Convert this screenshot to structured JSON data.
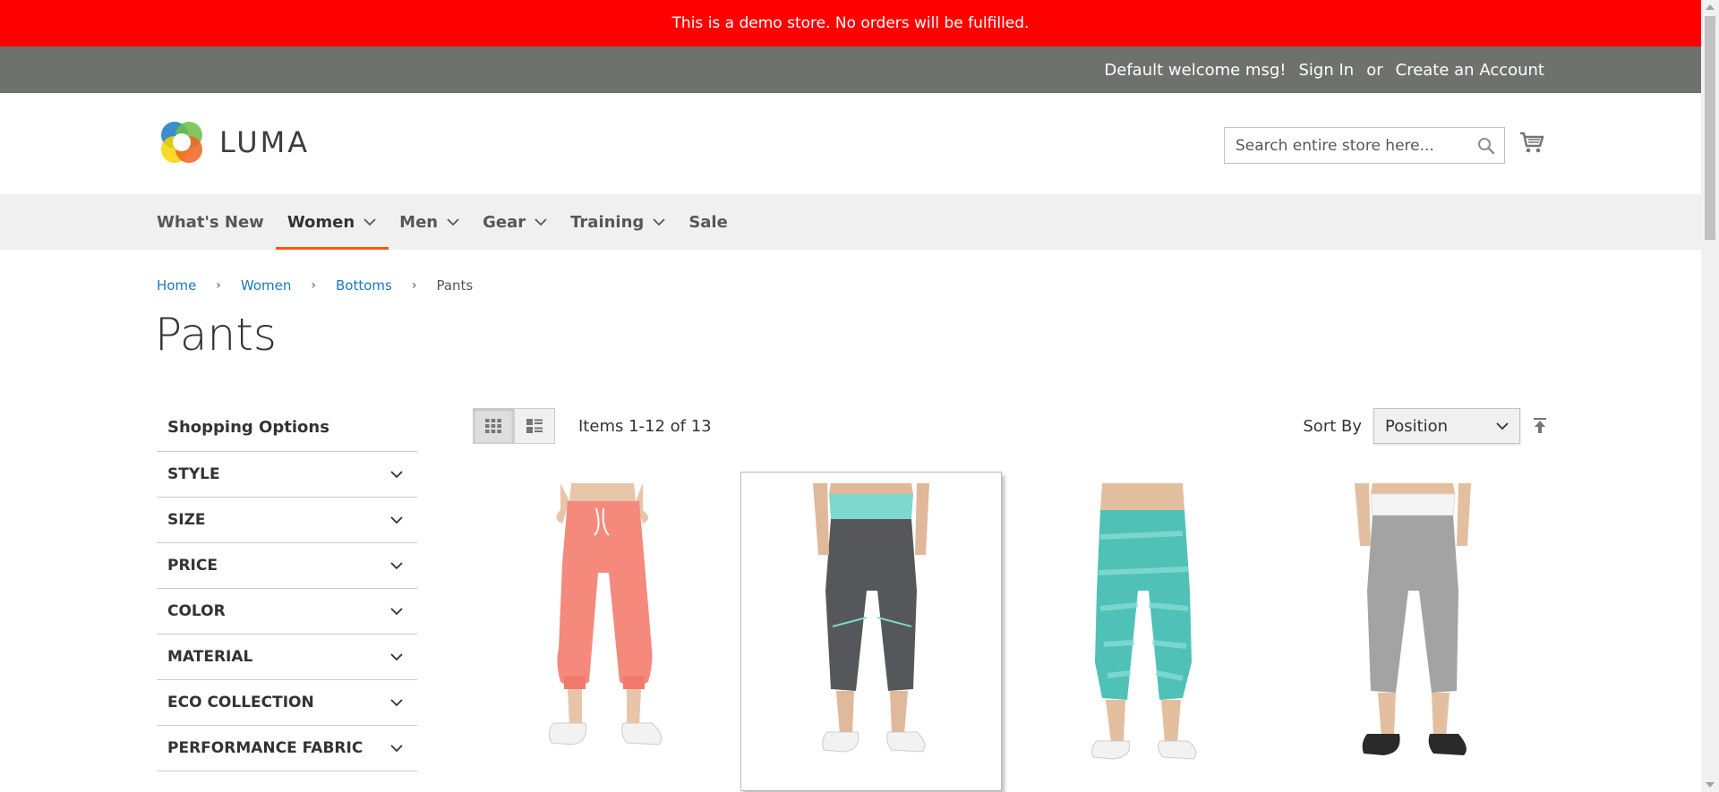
{
  "demo_notice": "This is a demo store. No orders will be fulfilled.",
  "header": {
    "welcome": "Default welcome msg!",
    "sign_in": "Sign In",
    "or": "or",
    "create_account": "Create an Account",
    "logo_text": "LUMA",
    "search_placeholder": "Search entire store here..."
  },
  "nav": {
    "items": [
      {
        "label": "What's New",
        "has_menu": false
      },
      {
        "label": "Women",
        "has_menu": true,
        "active": true
      },
      {
        "label": "Men",
        "has_menu": true
      },
      {
        "label": "Gear",
        "has_menu": true
      },
      {
        "label": "Training",
        "has_menu": true
      },
      {
        "label": "Sale",
        "has_menu": false
      }
    ]
  },
  "breadcrumbs": [
    "Home",
    "Women",
    "Bottoms",
    "Pants"
  ],
  "page_title": "Pants",
  "sidebar": {
    "title": "Shopping Options",
    "filters": [
      "Style",
      "Size",
      "Price",
      "Color",
      "Material",
      "Eco Collection",
      "Performance Fabric"
    ]
  },
  "toolbar": {
    "amount": "Items 1-12 of 13",
    "sort_label": "Sort By",
    "sort_value": "Position"
  },
  "colors": {
    "demo_bar": "#ff0000",
    "panel_header": "#6e716e",
    "nav_bg": "#f0f0f0",
    "active_underline": "#ff5501",
    "link": "#1979c3"
  },
  "products": [
    {
      "image": "pink-sweatpants"
    },
    {
      "image": "charcoal-capri-teal-band"
    },
    {
      "image": "teal-print-capri"
    },
    {
      "image": "gray-capri-white-band"
    }
  ]
}
